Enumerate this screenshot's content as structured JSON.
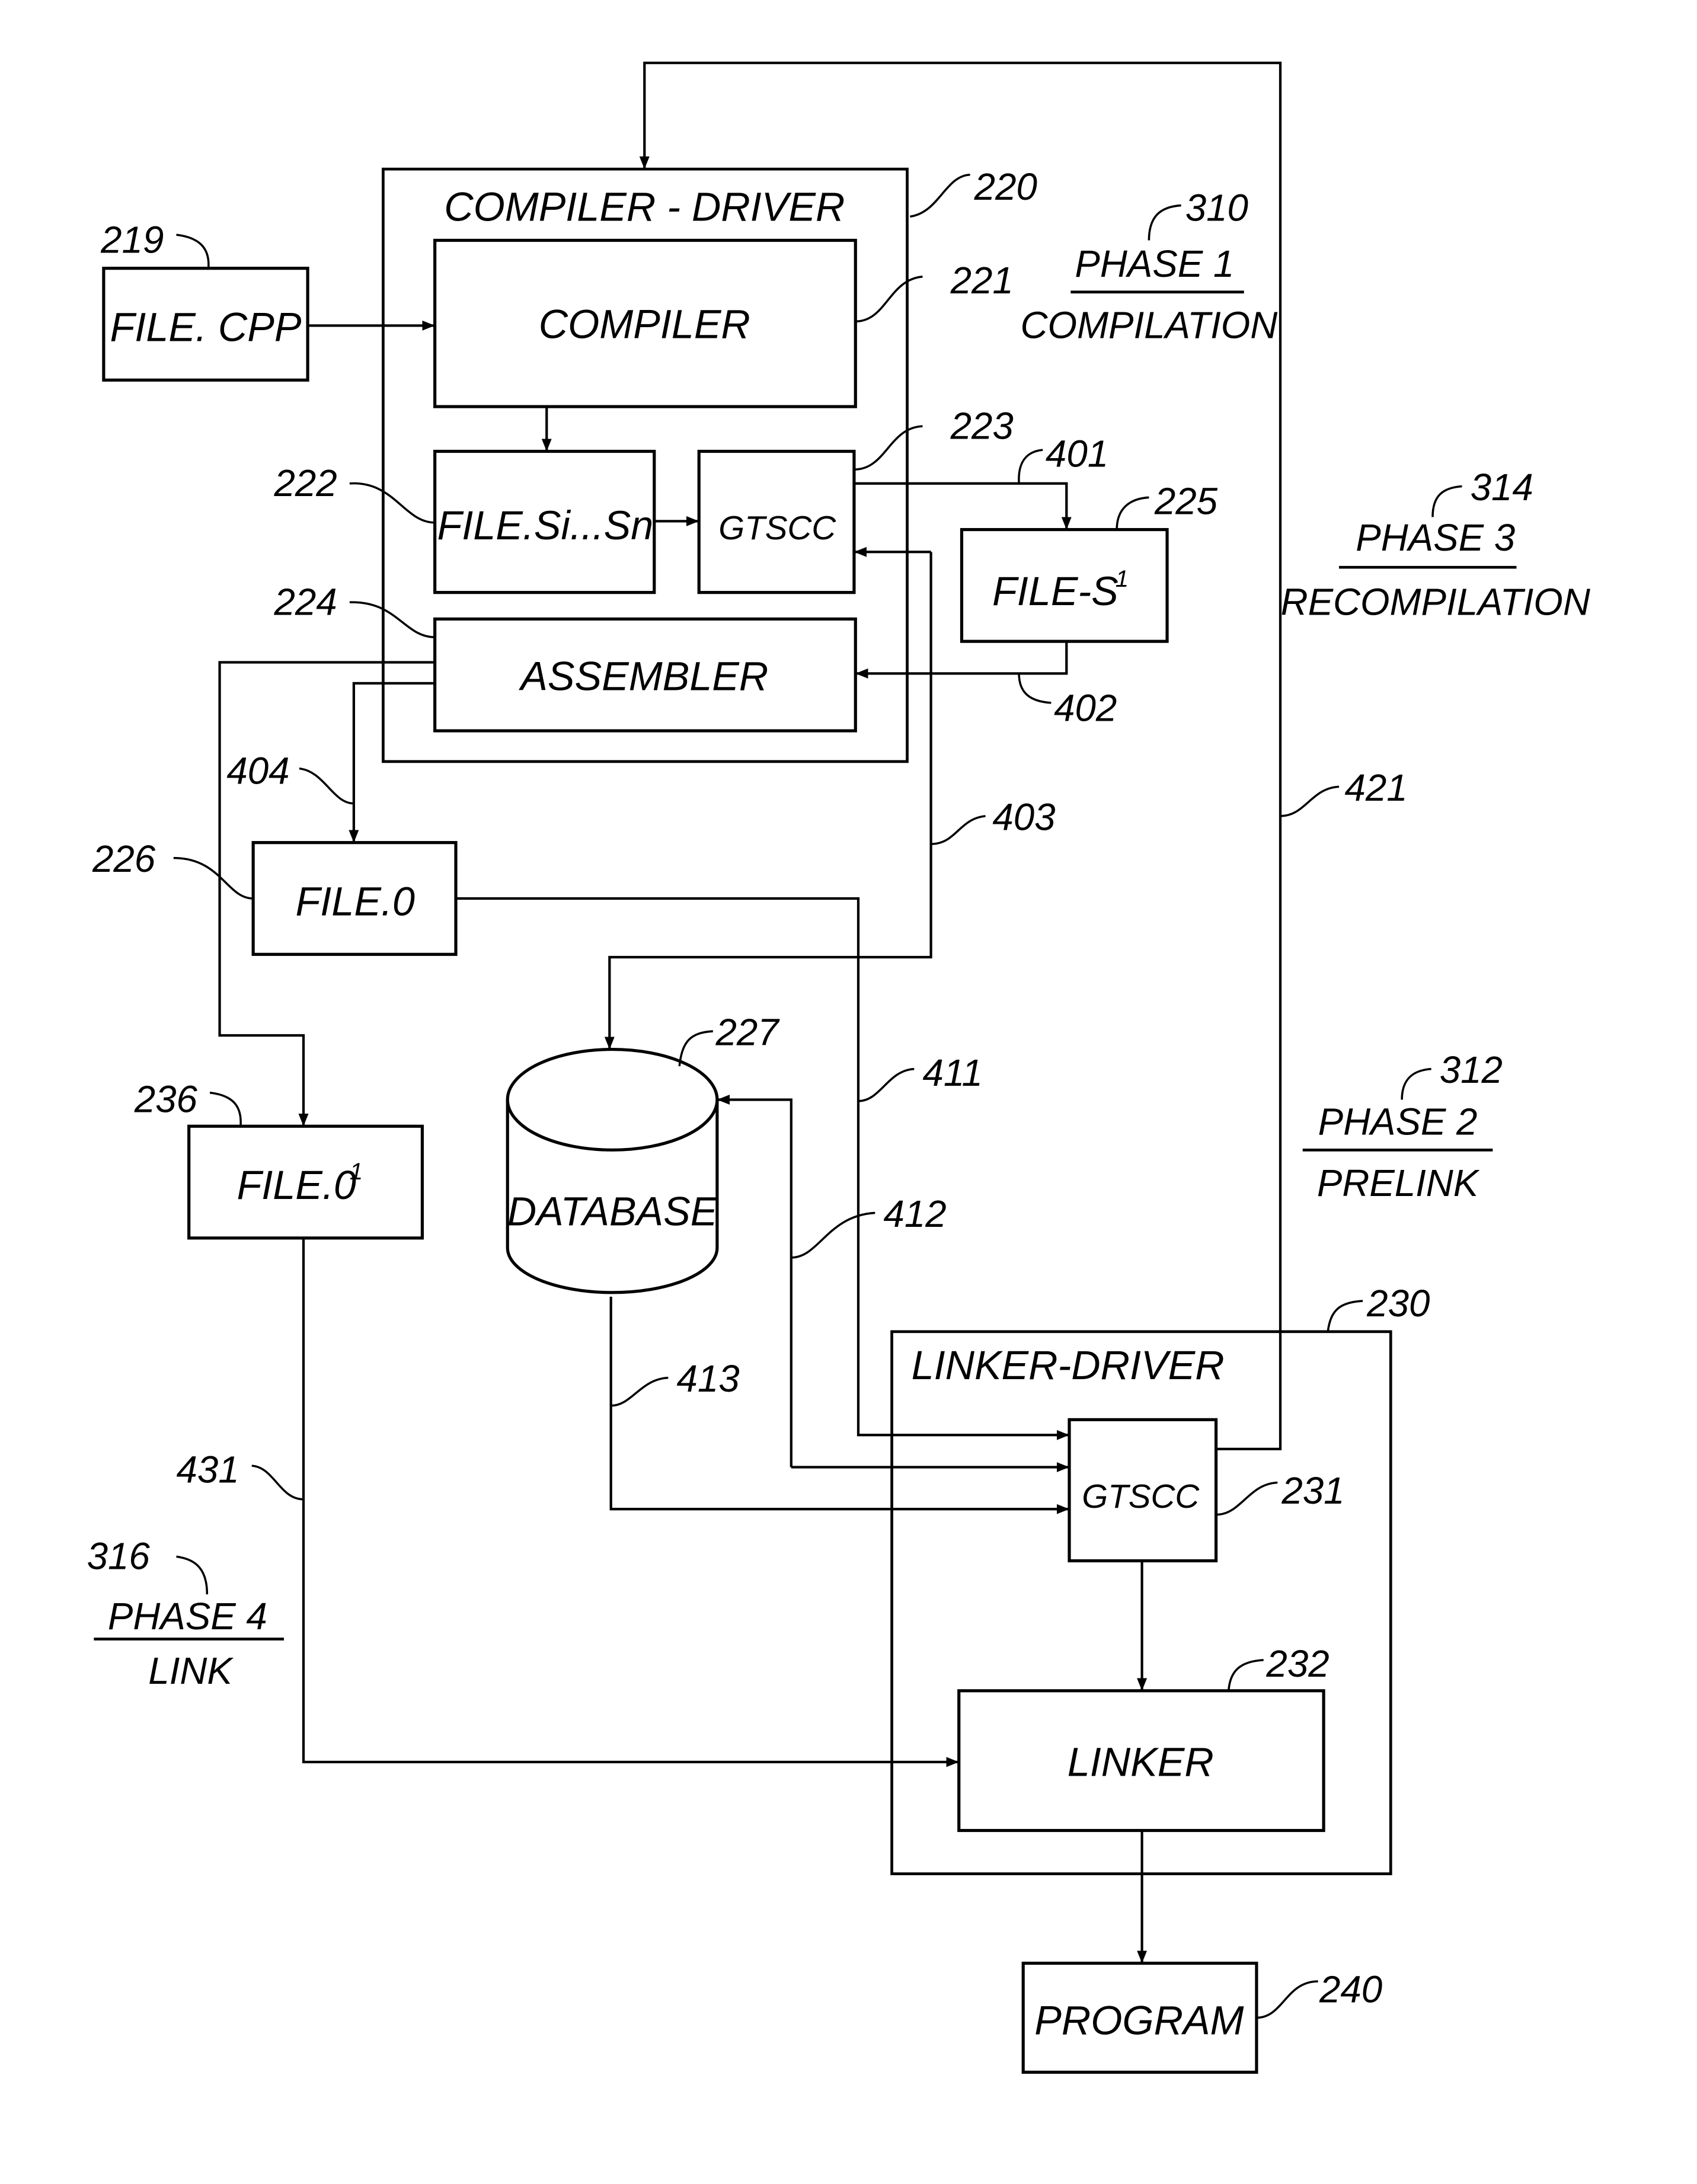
{
  "figure": {
    "blocks": {
      "file_cpp": {
        "label": "FILE. CPP",
        "ref": "219"
      },
      "compiler_driver": {
        "label": "COMPILER - DRIVER",
        "ref": "220"
      },
      "compiler": {
        "label": "COMPILER",
        "ref": "221"
      },
      "file_si_sn": {
        "label": "FILE.Si...Sn",
        "ref": "222"
      },
      "gtscc_compile": {
        "label": "GTSCC",
        "ref": "223"
      },
      "assembler": {
        "label": "ASSEMBLER",
        "ref": "224"
      },
      "file_s1": {
        "label": "FILE-S",
        "sup": "1",
        "ref": "225"
      },
      "file_o": {
        "label": "FILE.0",
        "ref": "226"
      },
      "database": {
        "label": "DATABASE",
        "ref": "227"
      },
      "file_o1": {
        "label": "FILE.0",
        "sup": "1",
        "ref": "236"
      },
      "linker_driver": {
        "label": "LINKER-DRIVER",
        "ref": "230"
      },
      "gtscc_link": {
        "label": "GTSCC",
        "ref": "231"
      },
      "linker": {
        "label": "LINKER",
        "ref": "232"
      },
      "program": {
        "label": "PROGRAM",
        "ref": "240"
      }
    },
    "connections": {
      "c401": "401",
      "c402": "402",
      "c403": "403",
      "c404": "404",
      "c411": "411",
      "c412": "412",
      "c413": "413",
      "c421": "421",
      "c431": "431"
    },
    "phases": [
      {
        "ref": "310",
        "title": "PHASE 1",
        "name": "COMPILATION"
      },
      {
        "ref": "312",
        "title": "PHASE 2",
        "name": "PRELINK"
      },
      {
        "ref": "314",
        "title": "PHASE 3",
        "name": "RECOMPILATION"
      },
      {
        "ref": "316",
        "title": "PHASE 4",
        "name": "LINK"
      }
    ]
  }
}
